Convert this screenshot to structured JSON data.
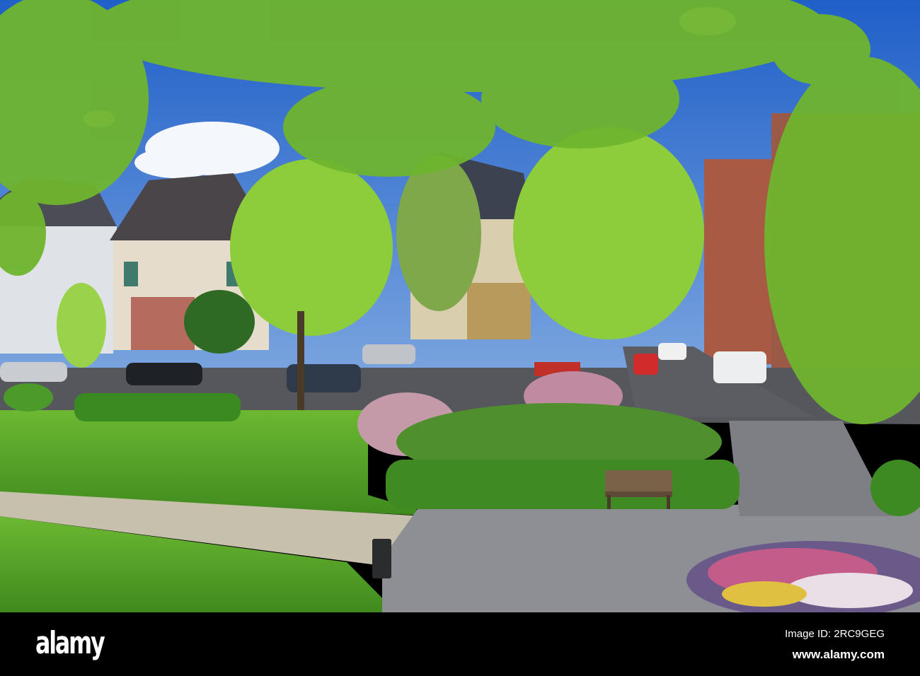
{
  "banner": {
    "logo": "alamy",
    "image_id": "Image ID: 2RC9GEG",
    "url": "www.alamy.com"
  },
  "colors": {
    "sky": "#2f6fd0",
    "foliage": "#7cc23a",
    "lawn": "#5aa22a",
    "road": "#4d4f55",
    "paving": "#8a8c90"
  }
}
